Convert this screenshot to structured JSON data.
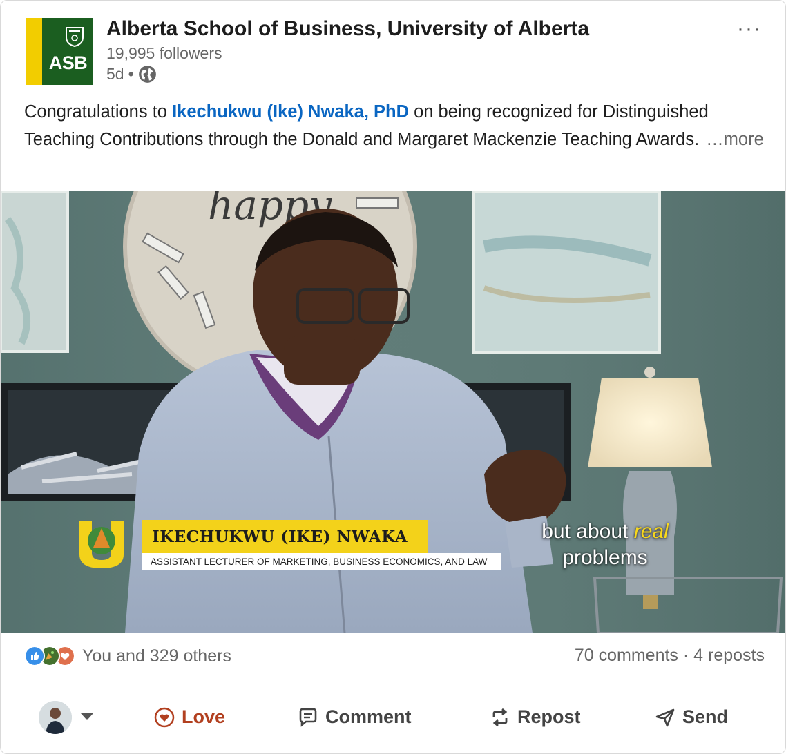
{
  "post": {
    "org_name": "Alberta School of Business, University of Alberta",
    "followers": "19,995 followers",
    "time": "5d",
    "separator": "•",
    "more_menu": "···",
    "logo_text": "ASB",
    "text_before": "Congratulations to ",
    "mention": "Ikechukwu (Ike) Nwaka, PhD",
    "text_after": " on being recognized for Distinguished Teaching Contributions through the Donald and Margaret Mackenzie Teaching Awards.",
    "see_more": "…more"
  },
  "video": {
    "name": "IKECHUKWU (IKE) NWAKA",
    "title": "ASSISTANT LECTURER OF MARKETING, BUSINESS ECONOMICS, AND LAW",
    "caption_prefix": "but about ",
    "caption_highlight": "real",
    "caption_line2": "problems",
    "clock_text": "happy"
  },
  "social": {
    "reactions_text": "You and 329 others",
    "comments": "70 comments",
    "dot": " · ",
    "reposts": "4 reposts"
  },
  "actions": {
    "love": "Love",
    "comment": "Comment",
    "repost": "Repost",
    "send": "Send"
  },
  "colors": {
    "link_blue": "#0a66c2",
    "love_red": "#b24020",
    "asb_green": "#1b5e20",
    "asb_gold": "#f2cd00"
  }
}
